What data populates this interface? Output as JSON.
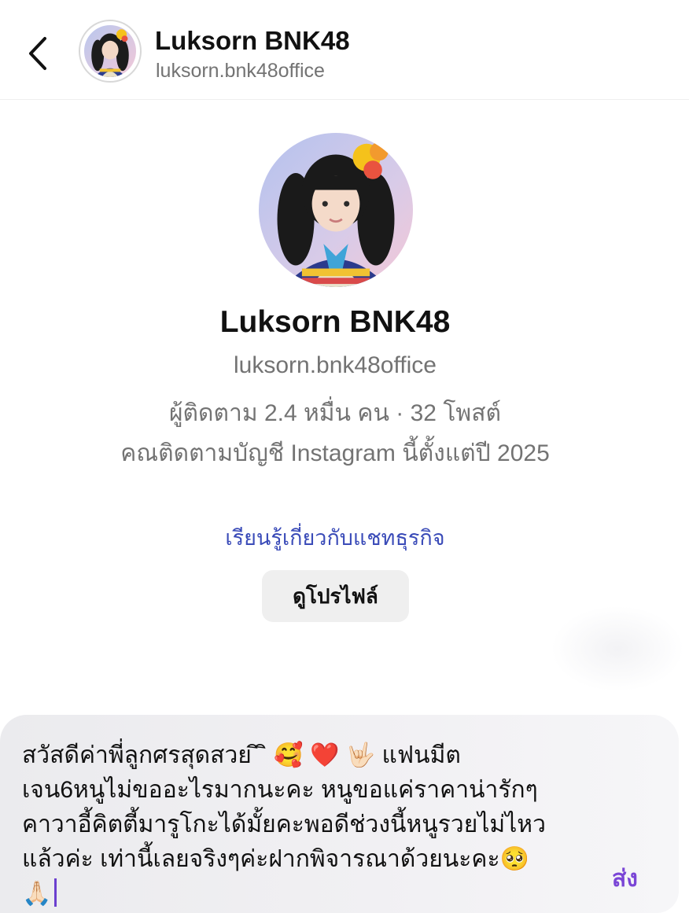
{
  "header": {
    "back_icon": "chevron-left-icon",
    "name": "Luksorn BNK48",
    "handle": "luksorn.bnk48office"
  },
  "profile": {
    "name": "Luksorn BNK48",
    "handle": "luksorn.bnk48office",
    "stats": "ผู้ติดตาม 2.4 หมื่น คน · 32 โพสต์",
    "since": "คณติดตามบัญชี Instagram นี้ตั้งแต่ปี 2025",
    "business_link": "เรียนรู้เกี่ยวกับแชทธุรกิจ",
    "view_profile_label": "ดูโปรไฟล์"
  },
  "composer": {
    "message": "สวัสดีค่าพี่ลูกศรสุดสวย ิ ิ 🥰 ❤️ 🤟🏻 แฟนมีต\nเจน6หนูไม่ขออะไรมากนะคะ หนูขอแค่ราคาน่ารักๆ\nคาวาอี้คิตตี้มารูโกะได้มั้ยคะพอดีช่วงนี้หนูรวยไม่ไหว\nแล้วค่ะ เท่านี้เลยจริงๆค่ะฝากพิจารณาด้วยนะคะ🥺\n🙏🏻",
    "send_label": "ส่ง"
  },
  "colors": {
    "link": "#3a4bb8",
    "send": "#7a45d6",
    "muted_text": "#737373",
    "button_bg": "#efefef"
  }
}
